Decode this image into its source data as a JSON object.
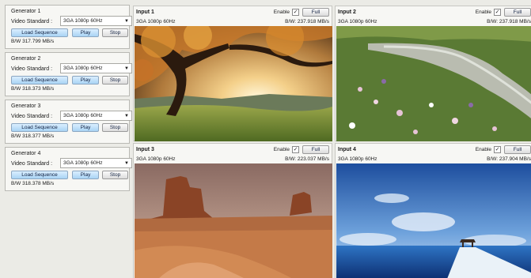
{
  "generators": [
    {
      "title": "Generator 1",
      "video_standard_label": "Video Standard :",
      "video_standard": "3GA 1080p 60Hz",
      "load_label": "Load Sequence",
      "play_label": "Play",
      "stop_label": "Stop",
      "bandwidth": "B/W 317.799 MB/s"
    },
    {
      "title": "Generator 2",
      "video_standard_label": "Video Standard :",
      "video_standard": "3GA 1080p 60Hz",
      "load_label": "Load Sequence",
      "play_label": "Play",
      "stop_label": "Stop",
      "bandwidth": "B/W 318.373 MB/s"
    },
    {
      "title": "Generator 3",
      "video_standard_label": "Video Standard :",
      "video_standard": "3GA 1080p 60Hz",
      "load_label": "Load Sequence",
      "play_label": "Play",
      "stop_label": "Stop",
      "bandwidth": "B/W 318.377 MB/s"
    },
    {
      "title": "Generator 4",
      "video_standard_label": "Video Standard :",
      "video_standard": "3GA 1080p 60Hz",
      "load_label": "Load Sequence",
      "play_label": "Play",
      "stop_label": "Stop",
      "bandwidth": "B/W 318.378 MB/s"
    }
  ],
  "inputs": [
    {
      "name": "Input 1",
      "format": "3GA 1080p 60Hz",
      "bandwidth": "B/W: 237.918 MB/s",
      "enable_label": "Enable",
      "enabled": true,
      "full_label": "Full",
      "image_icon": "autumn-tree-sunset-image"
    },
    {
      "name": "Input 2",
      "format": "3GA 1080p 60Hz",
      "bandwidth": "B/W: 237.918 MB/s",
      "enable_label": "Enable",
      "enabled": true,
      "full_label": "Full",
      "image_icon": "meadow-stream-image"
    },
    {
      "name": "Input 3",
      "format": "3GA 1080p 60Hz",
      "bandwidth": "B/W: 223.037 MB/s",
      "enable_label": "Enable",
      "enabled": true,
      "full_label": "Full",
      "image_icon": "desert-buttes-image"
    },
    {
      "name": "Input 4",
      "format": "3GA 1080p 60Hz",
      "bandwidth": "B/W: 237.904 MB/s",
      "enable_label": "Enable",
      "enabled": true,
      "full_label": "Full",
      "image_icon": "ocean-pier-image"
    }
  ],
  "colors": {
    "button_blue": "#a9d3f4",
    "panel_bg": "#f7f7f4",
    "window_bg": "#ebebe6"
  }
}
